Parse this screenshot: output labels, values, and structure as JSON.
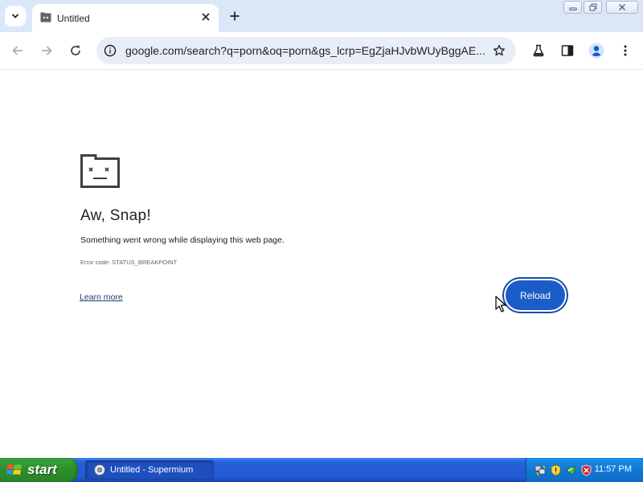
{
  "browser": {
    "tab_title": "Untitled",
    "url": "google.com/search?q=porn&oq=porn&gs_lcrp=EgZjaHJvbWUyBggAE..."
  },
  "error_page": {
    "title": "Aw, Snap!",
    "description": "Something went wrong while displaying this web page.",
    "error_code": "Error code: STATUS_BREAKPOINT",
    "learn_more": "Learn more",
    "reload_label": "Reload"
  },
  "taskbar": {
    "start_label": "start",
    "task_label": "Untitled - Supermium",
    "clock": "11:57 PM"
  },
  "colors": {
    "tabstrip": "#dbe6f8",
    "omnibox": "#e8eef7",
    "reload_button": "#1a5cc8",
    "taskbar": "#225bd2",
    "start_button": "#2b8f2b",
    "tray": "#1078d6"
  },
  "icons": {
    "tab_search": "chevron-down-icon",
    "favicon": "page-icon",
    "tab_close": "close-icon",
    "new_tab": "plus-icon",
    "back": "arrow-left-icon",
    "forward": "arrow-right-icon",
    "reload": "reload-icon",
    "site_info": "info-icon",
    "bookmark": "star-icon",
    "labs": "flask-icon",
    "side_panel": "side-panel-icon",
    "profile": "profile-icon",
    "menu": "kebab-menu-icon",
    "sad_tab": "sad-tab-icon",
    "windows_logo": "windows-logo-icon"
  }
}
